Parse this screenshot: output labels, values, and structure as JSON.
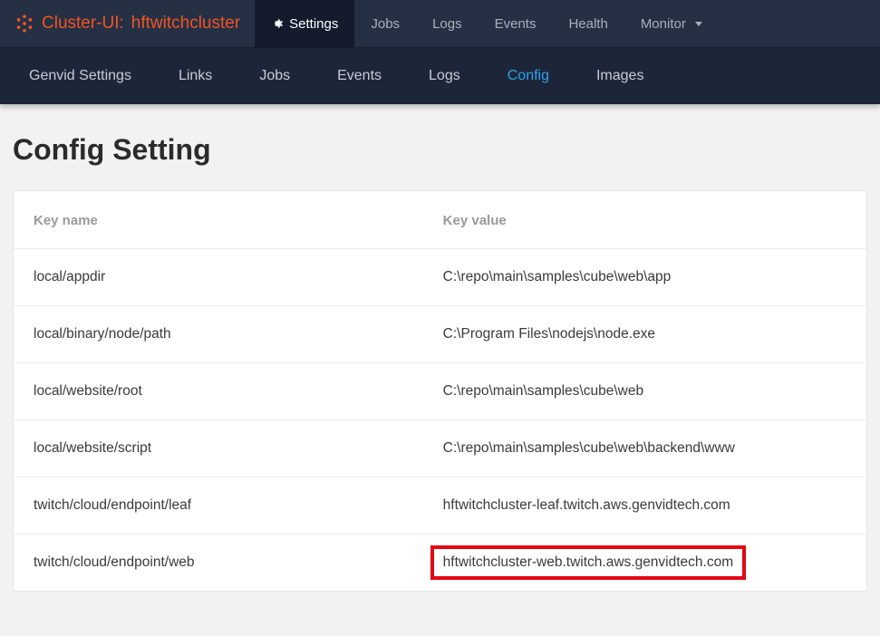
{
  "brand": {
    "prefix": "Cluster-UI:",
    "name": "hftwitchcluster"
  },
  "topnav": [
    {
      "label": "Settings",
      "icon": "gear",
      "active": true
    },
    {
      "label": "Jobs"
    },
    {
      "label": "Logs"
    },
    {
      "label": "Events"
    },
    {
      "label": "Health"
    },
    {
      "label": "Monitor",
      "caret": true
    }
  ],
  "subnav": [
    {
      "label": "Genvid Settings"
    },
    {
      "label": "Links"
    },
    {
      "label": "Jobs"
    },
    {
      "label": "Events"
    },
    {
      "label": "Logs"
    },
    {
      "label": "Config",
      "active": true
    },
    {
      "label": "Images"
    }
  ],
  "page": {
    "title": "Config Setting",
    "table": {
      "headers": {
        "key": "Key name",
        "value": "Key value"
      },
      "rows": [
        {
          "key": "local/appdir",
          "value": "C:\\repo\\main\\samples\\cube\\web\\app"
        },
        {
          "key": "local/binary/node/path",
          "value": "C:\\Program Files\\nodejs\\node.exe"
        },
        {
          "key": "local/website/root",
          "value": "C:\\repo\\main\\samples\\cube\\web"
        },
        {
          "key": "local/website/script",
          "value": "C:\\repo\\main\\samples\\cube\\web\\backend\\www"
        },
        {
          "key": "twitch/cloud/endpoint/leaf",
          "value": "hftwitchcluster-leaf.twitch.aws.genvidtech.com"
        },
        {
          "key": "twitch/cloud/endpoint/web",
          "value": "hftwitchcluster-web.twitch.aws.genvidtech.com",
          "highlight": true
        }
      ]
    }
  }
}
